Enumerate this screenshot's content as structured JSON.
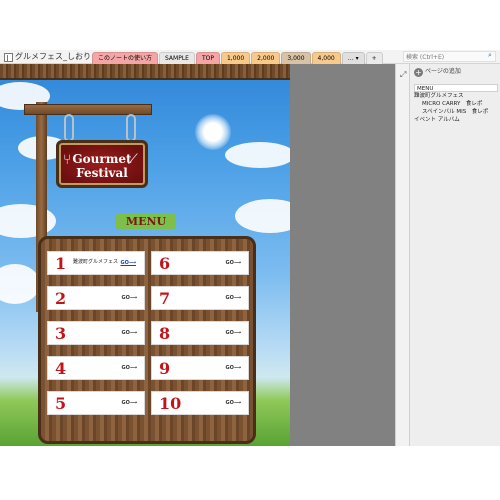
{
  "notebook": {
    "title": "グルメフェス_しおり",
    "dropdown_glyph": "▾"
  },
  "tabs": [
    {
      "label": "このノートの使い方",
      "color": "#f4a6a6"
    },
    {
      "label": "SAMPLE",
      "color": "#e8e8e8"
    },
    {
      "label": "TOP",
      "color": "#f4a6a6"
    },
    {
      "label": "1,000",
      "color": "#f7c98a"
    },
    {
      "label": "2,000",
      "color": "#f7c98a"
    },
    {
      "label": "3,000",
      "color": "#d9c2a5"
    },
    {
      "label": "4,000",
      "color": "#f7c98a"
    },
    {
      "label": "… ▾",
      "color": "#e0e0e0"
    },
    {
      "label": "+",
      "color": "#eaeaea"
    }
  ],
  "search": {
    "placeholder": "検索 (Ctrl+E)",
    "icon": "search-icon"
  },
  "page_content": {
    "sign_line1": "Gourmet",
    "sign_line2": "Festival",
    "menu_label": "MENU",
    "items": [
      {
        "num": "1",
        "title": "難波町グルメフェス",
        "go": "GO⟶",
        "is_link": true
      },
      {
        "num": "2",
        "title": "",
        "go": "GO⟶",
        "is_link": false
      },
      {
        "num": "3",
        "title": "",
        "go": "GO⟶",
        "is_link": false
      },
      {
        "num": "4",
        "title": "",
        "go": "GO⟶",
        "is_link": false
      },
      {
        "num": "5",
        "title": "",
        "go": "GO⟶",
        "is_link": false
      },
      {
        "num": "6",
        "title": "",
        "go": "GO⟶",
        "is_link": false
      },
      {
        "num": "7",
        "title": "",
        "go": "GO⟶",
        "is_link": false
      },
      {
        "num": "8",
        "title": "",
        "go": "GO⟶",
        "is_link": false
      },
      {
        "num": "9",
        "title": "",
        "go": "GO⟶",
        "is_link": false
      },
      {
        "num": "10",
        "title": "",
        "go": "GO⟶",
        "is_link": false
      }
    ]
  },
  "panel": {
    "add_page_label": "ページの追加",
    "pages": [
      {
        "label": "MENU",
        "active": true,
        "sub": false
      },
      {
        "label": "難波町グルメフェス",
        "active": false,
        "sub": false
      },
      {
        "label": "MICRO CARRY　食レポ",
        "active": false,
        "sub": true
      },
      {
        "label": "スペインバル MIS　食レポ",
        "active": false,
        "sub": true
      },
      {
        "label": "イベント アルバム",
        "active": false,
        "sub": false
      }
    ]
  },
  "colors": {
    "accent_red": "#c0161b",
    "gutter_gray": "#818181",
    "menu_green": "#7cc04a"
  }
}
